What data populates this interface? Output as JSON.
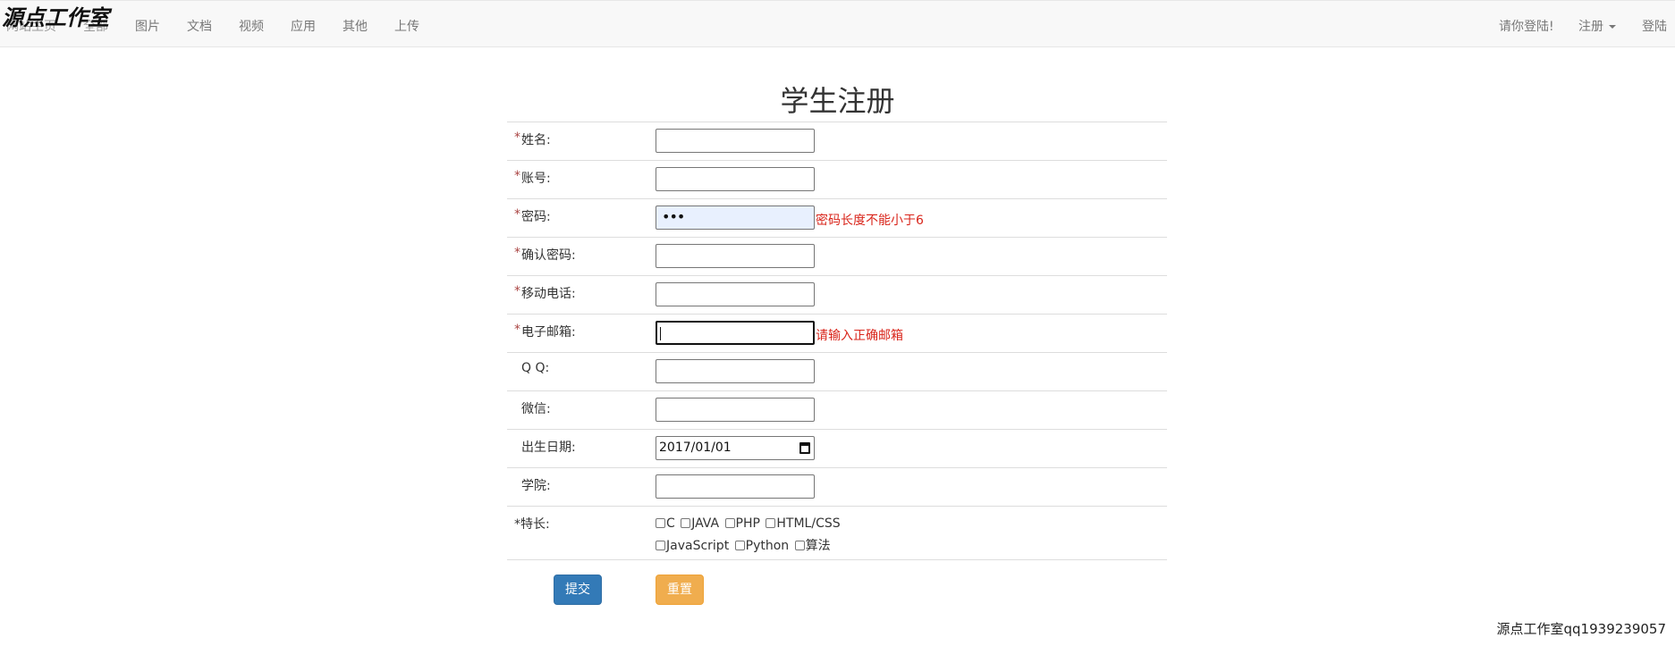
{
  "navbar": {
    "brand": "源点工作室",
    "links": [
      "网站主页",
      "全部",
      "图片",
      "文档",
      "视频",
      "应用",
      "其他",
      "上传"
    ],
    "right": {
      "login_prompt": "请你登陆!",
      "register": "注册",
      "login": "登陆"
    }
  },
  "form": {
    "title": "学生注册",
    "required_mark": "*",
    "fields": [
      {
        "label": "姓名:",
        "required": true,
        "value": ""
      },
      {
        "label": "账号:",
        "required": true,
        "value": ""
      },
      {
        "label": "密码:",
        "required": true,
        "value": "•••",
        "error": "密码长度不能小于6"
      },
      {
        "label": "确认密码:",
        "required": true,
        "value": ""
      },
      {
        "label": "移动电话:",
        "required": true,
        "value": ""
      },
      {
        "label": "电子邮箱:",
        "required": true,
        "value": "",
        "error": "请输入正确邮箱"
      },
      {
        "label": "Q Q:",
        "required": false,
        "value": ""
      },
      {
        "label": "微信:",
        "required": false,
        "value": ""
      },
      {
        "label": "出生日期:",
        "required": false,
        "value": "2017/01/01"
      },
      {
        "label": "学院:",
        "required": false,
        "value": ""
      }
    ],
    "skills": {
      "label": "*特长:",
      "options": [
        "C",
        "JAVA",
        "PHP",
        "HTML/CSS",
        "JavaScript",
        "Python",
        "算法"
      ]
    },
    "submit_label": "提交",
    "reset_label": "重置"
  },
  "footer": {
    "text": "源点工作室qq1939239057"
  },
  "colors": {
    "primary": "#337ab7",
    "warning": "#f0ad4e",
    "error": "#d9251b"
  }
}
